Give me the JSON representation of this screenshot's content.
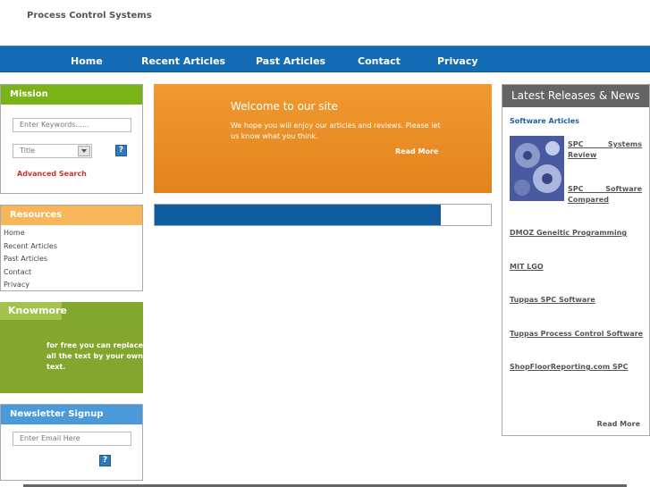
{
  "site": {
    "title": "Process Control Systems"
  },
  "nav": {
    "items": [
      "Home",
      "Recent Articles",
      "Past Articles",
      "Contact",
      "Privacy"
    ]
  },
  "mission": {
    "heading": "Mission",
    "keyword_placeholder": "Enter Keywords......",
    "select_value": "Title",
    "help_label": "?",
    "advanced_search": "Advanced Search"
  },
  "resources": {
    "heading": "Resources",
    "items": [
      "Home",
      "Recent Articles",
      "Past Articles",
      "Contact",
      "Privacy"
    ]
  },
  "knowmore": {
    "heading": "Knowmore",
    "text": "for free you can replace all the text by your own text."
  },
  "newsletter": {
    "heading": "Newsletter Signup",
    "email_placeholder": "Enter Email Here",
    "help_label": "?"
  },
  "welcome": {
    "title": "Welcome to our site",
    "body": "We hope you will enjoy our articles and reviews. Please let us know what you think.",
    "read_more": "Read More"
  },
  "news": {
    "heading": "Latest Releases & News",
    "subheading": "Software Articles",
    "feature_links": [
      "SPC Systems Review",
      "SPC Software Compared"
    ],
    "links": [
      "DMOZ Geneitic Programming",
      "MIT LGO",
      "Tuppas SPC Software",
      "Tuppas Process Control Software",
      "ShopFloorReporting.com SPC"
    ],
    "read_more": "Read More"
  },
  "colors": {
    "nav_blue": "#136bb3",
    "mission_green": "#7ab317",
    "resources_orange": "#f7b65a",
    "knowmore_green": "#82a62e",
    "newsletter_blue": "#4a9ad9",
    "welcome_orange": "#ea8d25",
    "news_gray": "#646464",
    "link_red": "#cc3333"
  },
  "icons": {
    "select_arrow": "chevron-down-icon",
    "help": "question-icon"
  },
  "progress": {
    "fill_fraction": 0.85
  }
}
